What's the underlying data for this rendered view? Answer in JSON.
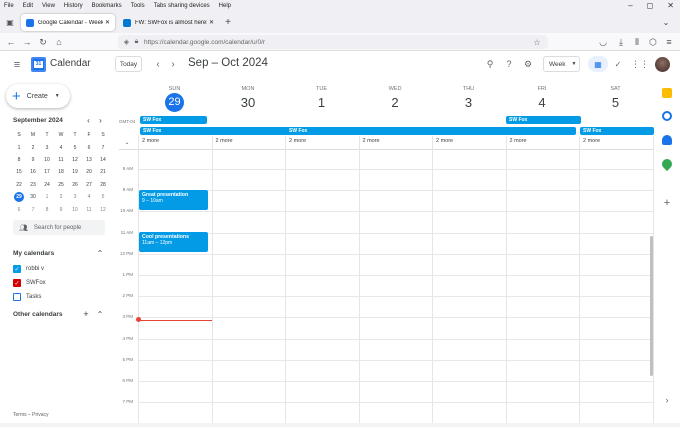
{
  "browser": {
    "menu": [
      "File",
      "Edit",
      "View",
      "History",
      "Bookmarks",
      "Tools",
      "Tabs sharing devices",
      "Help"
    ],
    "tabs": [
      {
        "title": "Google Calendar - Week of Sep",
        "active": true
      },
      {
        "title": "FW: SWFox is almost here! - rab",
        "active": false
      }
    ],
    "url": "https://calendar.google.com/calendar/u/0/r"
  },
  "header": {
    "app_name": "Calendar",
    "today_label": "Today",
    "date_range": "Sep – Oct 2024",
    "view_label": "Week"
  },
  "sidebar": {
    "create_label": "Create",
    "mini_cal": {
      "month_label": "September 2024",
      "weekday_heads": [
        "S",
        "M",
        "T",
        "W",
        "T",
        "F",
        "S"
      ],
      "weeks": [
        [
          "1",
          "2",
          "3",
          "4",
          "5",
          "6",
          "7"
        ],
        [
          "8",
          "9",
          "10",
          "11",
          "12",
          "13",
          "14"
        ],
        [
          "15",
          "16",
          "17",
          "18",
          "19",
          "20",
          "21"
        ],
        [
          "22",
          "23",
          "24",
          "25",
          "26",
          "27",
          "28"
        ],
        [
          "29",
          "30",
          "1",
          "2",
          "3",
          "4",
          "5"
        ],
        [
          "6",
          "7",
          "8",
          "9",
          "10",
          "11",
          "12"
        ]
      ]
    },
    "search_people_placeholder": "Search for people",
    "my_calendars_label": "My calendars",
    "my_calendars": [
      {
        "name": "robbi v",
        "color": "#039be5",
        "checked": true
      },
      {
        "name": "SWFox",
        "color": "#d50000",
        "checked": true
      },
      {
        "name": "Tasks",
        "color": "#1a73e8",
        "checked": false
      }
    ],
    "other_calendars_label": "Other calendars",
    "footer": "Terms – Privacy"
  },
  "week": {
    "timezone": "GMT-04",
    "days": [
      {
        "dow": "SUN",
        "date": "29",
        "today": true
      },
      {
        "dow": "MON",
        "date": "30",
        "today": false
      },
      {
        "dow": "TUE",
        "date": "1",
        "today": false
      },
      {
        "dow": "WED",
        "date": "2",
        "today": false
      },
      {
        "dow": "THU",
        "date": "3",
        "today": false
      },
      {
        "dow": "FRI",
        "date": "4",
        "today": false
      },
      {
        "dow": "SAT",
        "date": "5",
        "today": false
      }
    ],
    "all_day_label": "SW Fox",
    "more_labels": [
      "2 more",
      "2 more",
      "2 more",
      "2 more",
      "2 more",
      "2 more",
      "2 more"
    ],
    "hours": [
      "8 AM",
      "9 AM",
      "10 AM",
      "11 AM",
      "12 PM",
      "1 PM",
      "2 PM",
      "3 PM",
      "4 PM",
      "5 PM",
      "6 PM",
      "7 PM"
    ],
    "events": [
      {
        "title": "Great presentation",
        "time": "9 – 10am"
      },
      {
        "title": "Cool presentations",
        "time": "11am – 12pm"
      }
    ],
    "event_color": "#039be5",
    "accent_color": "#1a73e8",
    "now_color": "#ea4335"
  }
}
